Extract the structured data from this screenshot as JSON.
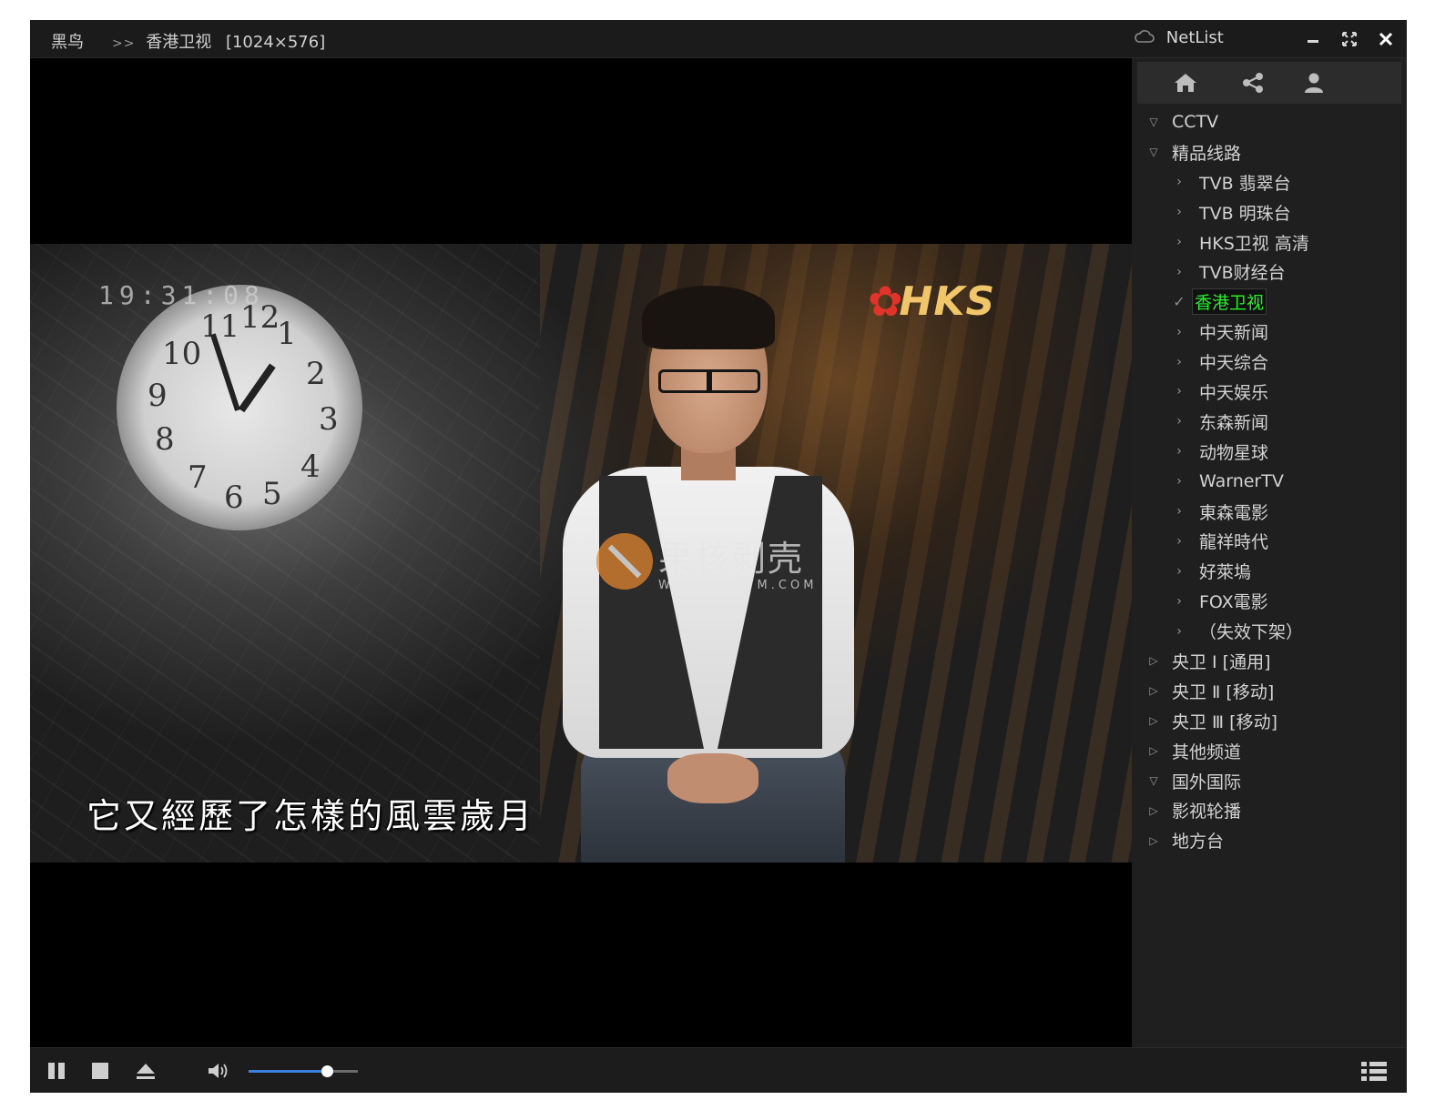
{
  "titlebar": {
    "app_name": "黑鸟",
    "separator": ">>",
    "channel": "香港卫视",
    "resolution": "[1024×576]",
    "panel_title": "NetList",
    "icons": {
      "cloud": "cloud-icon",
      "minimize": "minimize-icon",
      "maximize": "maximize-icon",
      "close": "close-icon"
    }
  },
  "video": {
    "timestamp": "19:31:08",
    "logo": "HKS",
    "subtitle": "它又經歷了怎樣的風雲歲月",
    "watermark": {
      "name": "果核剥壳",
      "url": "WWW.GHPYM.COM"
    }
  },
  "panel": {
    "toolbar": [
      "home-icon",
      "share-icon",
      "user-icon"
    ],
    "tree": [
      {
        "label": "CCTV",
        "level": 0,
        "state": "expanded"
      },
      {
        "label": "精品线路",
        "level": 0,
        "state": "expanded"
      },
      {
        "label": "TVB 翡翠台",
        "level": 1
      },
      {
        "label": "TVB 明珠台",
        "level": 1
      },
      {
        "label": "HKS卫视 高清",
        "level": 1
      },
      {
        "label": "TVB财经台",
        "level": 1
      },
      {
        "label": "香港卫视",
        "level": 1,
        "active": true
      },
      {
        "label": "中天新闻",
        "level": 1
      },
      {
        "label": "中天综合",
        "level": 1
      },
      {
        "label": "中天娱乐",
        "level": 1
      },
      {
        "label": "东森新闻",
        "level": 1
      },
      {
        "label": "动物星球",
        "level": 1
      },
      {
        "label": "WarnerTV",
        "level": 1
      },
      {
        "label": "東森電影",
        "level": 1
      },
      {
        "label": "龍祥時代",
        "level": 1
      },
      {
        "label": "好萊塢",
        "level": 1
      },
      {
        "label": "FOX電影",
        "level": 1
      },
      {
        "label": "（失效下架）",
        "level": 1
      },
      {
        "label": "央卫 Ⅰ [通用]",
        "level": 0,
        "state": "collapsed"
      },
      {
        "label": "央卫 Ⅱ [移动]",
        "level": 0,
        "state": "collapsed"
      },
      {
        "label": "央卫 Ⅲ [移动]",
        "level": 0,
        "state": "collapsed"
      },
      {
        "label": "其他频道",
        "level": 0,
        "state": "collapsed"
      },
      {
        "label": "国外国际",
        "level": 0,
        "state": "expanded"
      },
      {
        "label": "影视轮播",
        "level": 0,
        "state": "collapsed"
      },
      {
        "label": "地方台",
        "level": 0,
        "state": "collapsed"
      }
    ]
  },
  "controls": {
    "volume_fraction": 0.72,
    "icons": [
      "pause-icon",
      "stop-icon",
      "eject-icon",
      "volume-icon",
      "playlist-icon"
    ],
    "colors": {
      "accent": "#3d7fe0",
      "active_channel": "#28f028"
    }
  }
}
